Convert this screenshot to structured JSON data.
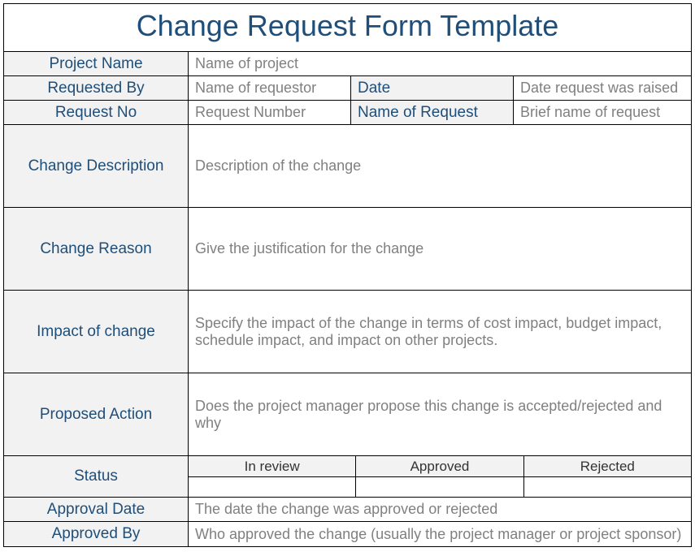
{
  "title": "Change Request Form Template",
  "labels": {
    "project_name": "Project Name",
    "requested_by": "Requested By",
    "date": "Date",
    "request_no": "Request No",
    "name_of_request": "Name of Request",
    "change_description": "Change Description",
    "change_reason": "Change Reason",
    "impact_of_change": "Impact of change",
    "proposed_action": "Proposed Action",
    "status": "Status",
    "approval_date": "Approval Date",
    "approved_by": "Approved By"
  },
  "placeholders": {
    "project_name": "Name of project",
    "requested_by": "Name of requestor",
    "date": "Date request was raised",
    "request_no": "Request Number",
    "name_of_request": "Brief name of request",
    "change_description": "Description of the change",
    "change_reason": "Give the justification for the change",
    "impact_of_change": "Specify the impact of the change in terms of cost impact, budget impact, schedule impact, and impact on other projects.",
    "proposed_action": "Does the project manager propose this change is accepted/rejected and why",
    "approval_date": "The date the change was approved or rejected",
    "approved_by": "Who approved the change (usually the project manager or project sponsor)"
  },
  "status_options": {
    "in_review": "In review",
    "approved": "Approved",
    "rejected": "Rejected"
  }
}
